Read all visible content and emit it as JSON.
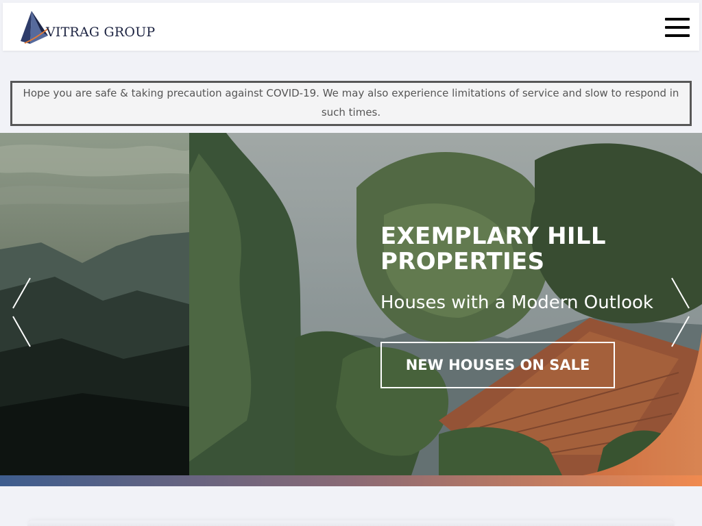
{
  "header": {
    "brand": "Vitrag Group",
    "brand_display": "VITRAG GROUP",
    "logo_icon": "pyramid-logo-icon",
    "menu_icon": "hamburger-menu-icon"
  },
  "notice": {
    "text": "Hope you are safe & taking precaution against COVID-19. We may also experience limitations of service and slow to respond in such times."
  },
  "hero": {
    "title": "EXEMPLARY HILL PROPERTIES",
    "subtitle": "Houses with a Modern Outlook",
    "cta_label": "NEW HOUSES ON SALE",
    "prev_icon": "chevron-left-icon",
    "next_icon": "chevron-right-icon"
  },
  "colors": {
    "brand_navy": "#1c2341",
    "accent_orange": "#f08a4f",
    "strip_blue": "#3e5d8e",
    "notice_border": "#575757",
    "page_bg": "#f1f2f7"
  }
}
